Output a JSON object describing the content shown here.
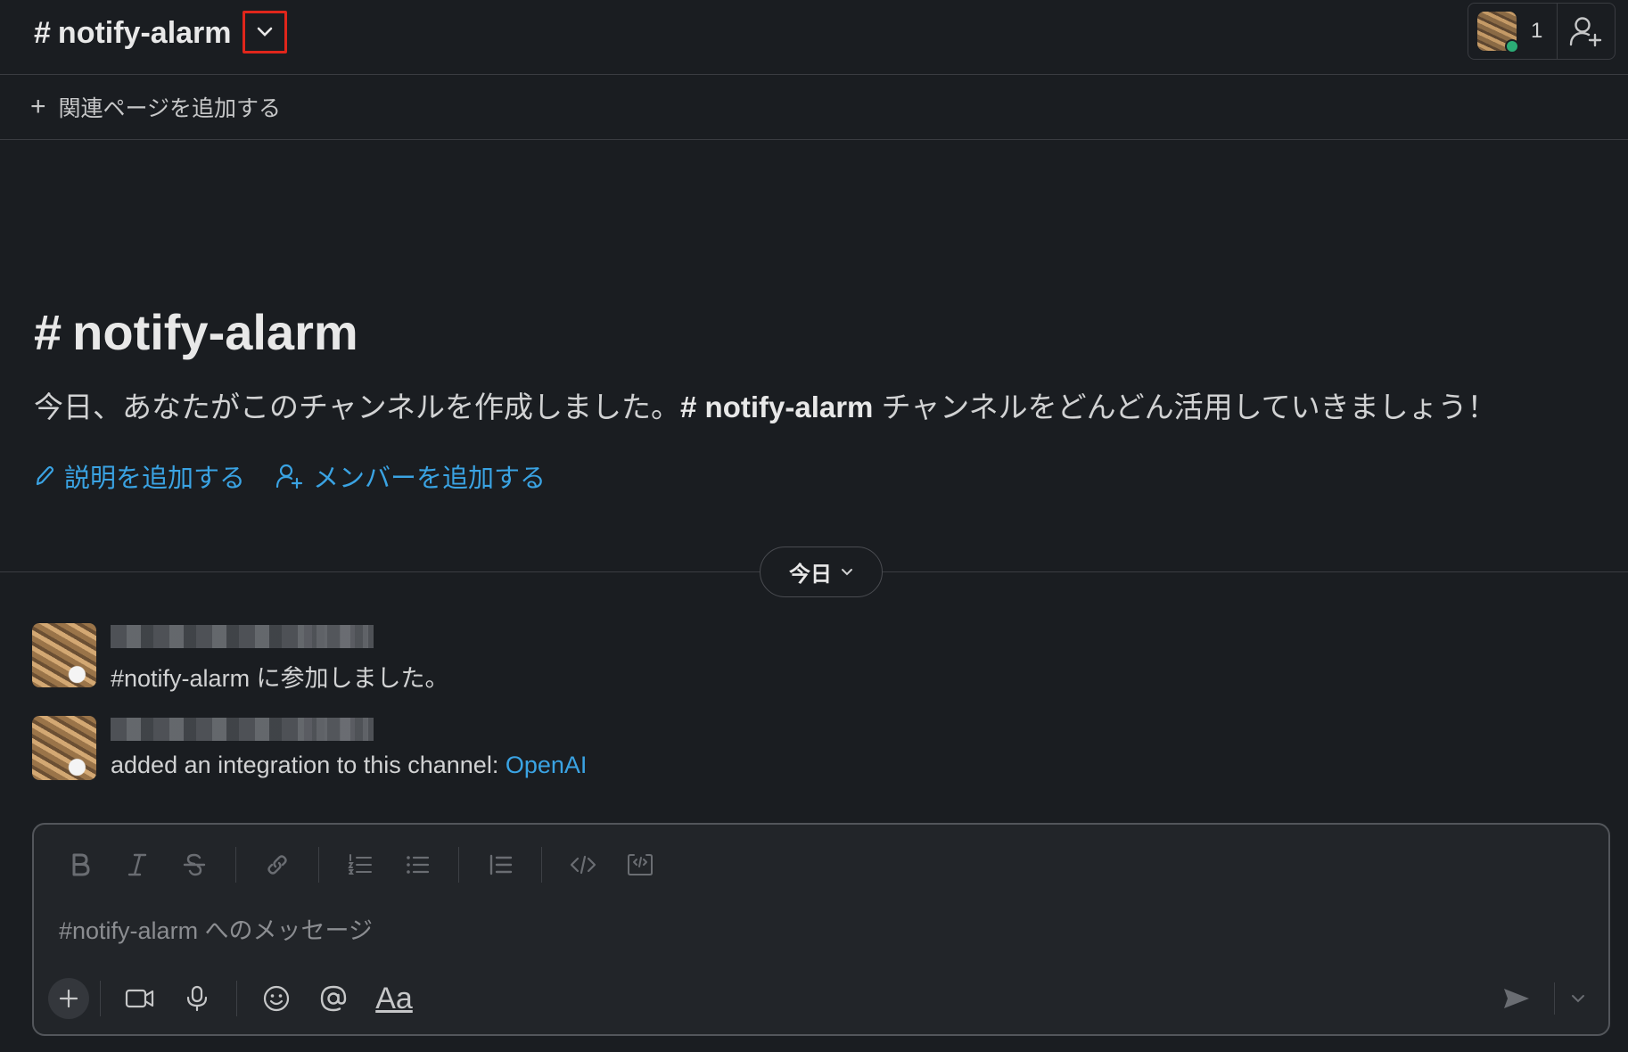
{
  "header": {
    "channel_hash": "#",
    "channel_name": "notify-alarm",
    "member_count": "1"
  },
  "bookmarks": {
    "add_label": "関連ページを追加する"
  },
  "intro": {
    "title_hash": "#",
    "title": "notify-alarm",
    "desc_before": "今日、あなたがこのチャンネルを作成しました。",
    "desc_channel": "# notify-alarm",
    "desc_after": " チャンネルをどんどん活用していきましょう！",
    "add_description": "説明を追加する",
    "add_members": "メンバーを追加する"
  },
  "divider": {
    "date_label": "今日"
  },
  "messages": [
    {
      "text": "#notify-alarm に参加しました。"
    },
    {
      "text_before": "added an integration to this channel: ",
      "link": "OpenAI"
    }
  ],
  "composer": {
    "placeholder": "#notify-alarm へのメッセージ",
    "format_label": "Aa"
  },
  "colors": {
    "background": "#1a1d21",
    "link": "#3aa3e3",
    "highlight_box": "#e0261b",
    "presence": "#2bac76"
  },
  "icons": [
    "chevron-down-icon",
    "add-user-icon",
    "plus-icon",
    "pencil-icon",
    "bold-icon",
    "italic-icon",
    "strikethrough-icon",
    "link-icon",
    "ordered-list-icon",
    "bulleted-list-icon",
    "blockquote-icon",
    "code-icon",
    "code-block-icon",
    "video-icon",
    "microphone-icon",
    "emoji-icon",
    "mention-icon",
    "send-icon"
  ]
}
